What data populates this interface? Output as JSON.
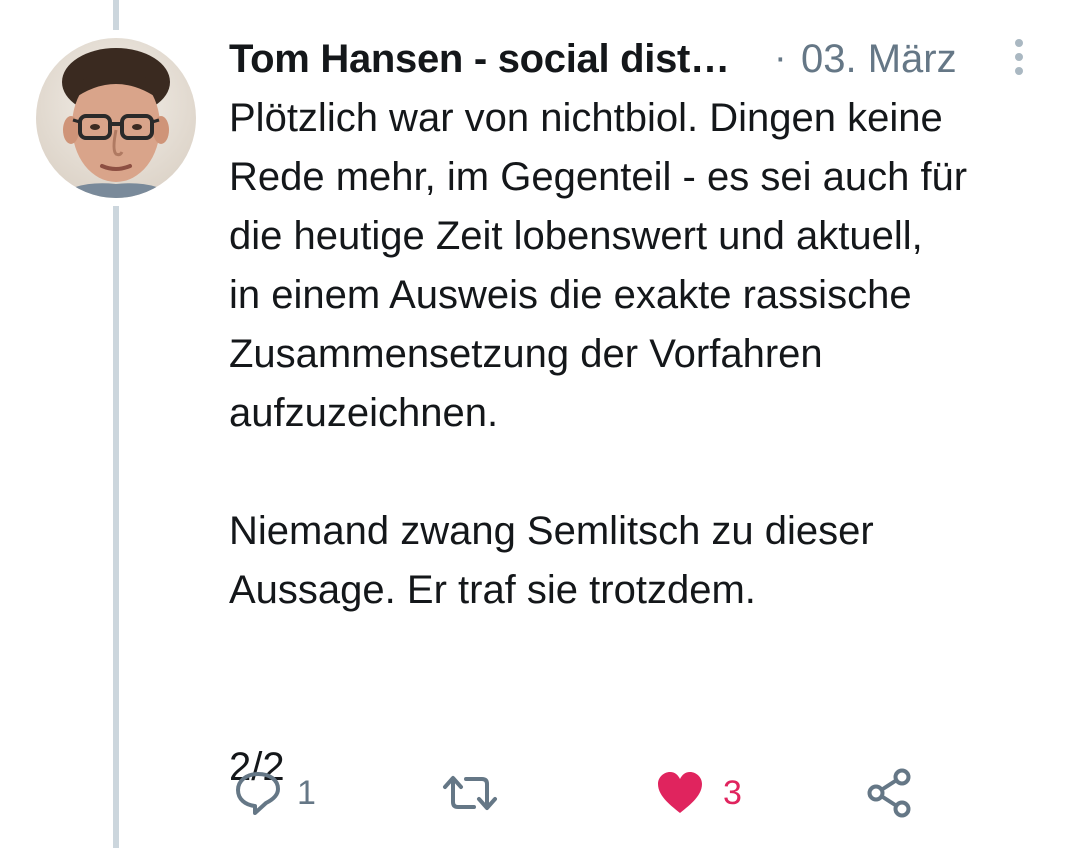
{
  "tweet": {
    "author_name": "Tom Hansen - social dist…",
    "separator": "·",
    "timestamp": "03. März",
    "body": "Plötzlich war von nichtbiol. Dingen keine\nRede mehr, im Gegenteil - es sei auch für\ndie heutige Zeit lobenswert und aktuell,\nin einem Ausweis die exakte rassische\nZusammensetzung der Vorfahren\naufzuzeichnen.\n\nNiemand zwang Semlitsch zu dieser\nAussage. Er traf sie trotzdem.\n\n\n2/2"
  },
  "actions": {
    "reply_count": "1",
    "like_count": "3",
    "like_color": "#e0245e",
    "icons": [
      "reply-icon",
      "retweet-icon",
      "heart-icon",
      "share-icon"
    ]
  },
  "colors": {
    "text": "#14171a",
    "secondary": "#657786",
    "thread_line": "#ccd6dd"
  }
}
